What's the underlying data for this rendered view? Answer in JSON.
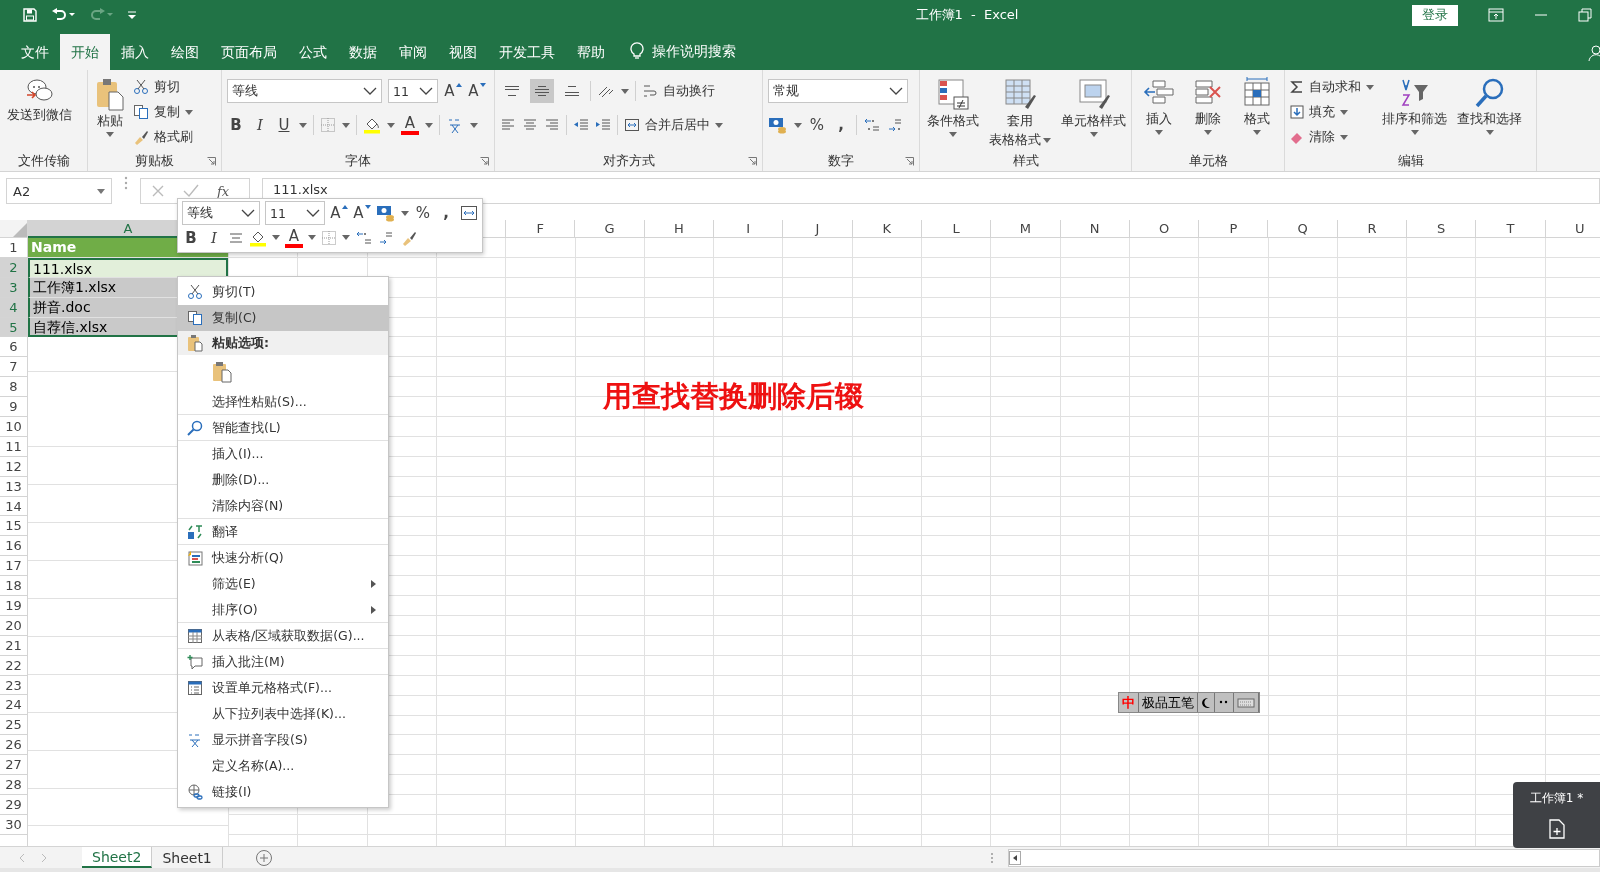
{
  "window": {
    "title": "工作簿1  -  Excel",
    "sign_in": "登录"
  },
  "menu_tabs": [
    {
      "label": "文件",
      "selected": false
    },
    {
      "label": "开始",
      "selected": true
    },
    {
      "label": "插入",
      "selected": false
    },
    {
      "label": "绘图",
      "selected": false
    },
    {
      "label": "页面布局",
      "selected": false
    },
    {
      "label": "公式",
      "selected": false
    },
    {
      "label": "数据",
      "selected": false
    },
    {
      "label": "审阅",
      "selected": false
    },
    {
      "label": "视图",
      "selected": false
    },
    {
      "label": "开发工具",
      "selected": false
    },
    {
      "label": "帮助",
      "selected": false
    }
  ],
  "tell_me": "操作说明搜索",
  "ribbon": {
    "file_transfer": {
      "button": "发送到微信",
      "group": "文件传输"
    },
    "clipboard": {
      "paste": "粘贴",
      "cut": "剪切",
      "copy": "复制",
      "format_painter": "格式刷",
      "group": "剪贴板"
    },
    "font": {
      "name": "等线",
      "size": "11",
      "grow": "A",
      "shrink": "A",
      "bold": "B",
      "italic": "I",
      "underline": "U",
      "font_color": "A",
      "group": "字体"
    },
    "alignment": {
      "vertical": [
        {
          "selected": false
        },
        {
          "selected": true
        },
        {
          "selected": false
        }
      ],
      "wrap": "自动换行",
      "merge": "合并后居中",
      "group": "对齐方式"
    },
    "number": {
      "format": "常规",
      "percent": "%",
      "comma": ",",
      "group": "数字"
    },
    "styles": {
      "conditional": "条件格式",
      "table_line1": "套用",
      "table_line2": "表格格式",
      "cell_styles": "单元格样式",
      "group": "样式"
    },
    "cells": {
      "insert": "插入",
      "delete": "删除",
      "format": "格式",
      "group": "单元格"
    },
    "editing": {
      "autosum": "自动求和",
      "fill": "填充",
      "clear": "清除",
      "sort": "排序和筛选",
      "find": "查找和选择",
      "group": "编辑"
    }
  },
  "formula_bar": {
    "name_box": "A2",
    "function_label": "fx",
    "value": "111.xlsx"
  },
  "grid": {
    "columns": [
      {
        "label": "A",
        "selected": true
      },
      {
        "label": "F",
        "selected": false
      },
      {
        "label": "G",
        "selected": false
      },
      {
        "label": "H",
        "selected": false
      },
      {
        "label": "I",
        "selected": false
      },
      {
        "label": "J",
        "selected": false
      },
      {
        "label": "K",
        "selected": false
      },
      {
        "label": "L",
        "selected": false
      },
      {
        "label": "M",
        "selected": false
      },
      {
        "label": "N",
        "selected": false
      },
      {
        "label": "O",
        "selected": false
      },
      {
        "label": "P",
        "selected": false
      },
      {
        "label": "Q",
        "selected": false
      },
      {
        "label": "R",
        "selected": false
      },
      {
        "label": "S",
        "selected": false
      },
      {
        "label": "T",
        "selected": false
      },
      {
        "label": "U",
        "selected": false
      }
    ],
    "rows": [
      {
        "label": "1",
        "selected": false
      },
      {
        "label": "2",
        "selected": true
      },
      {
        "label": "3",
        "selected": true
      },
      {
        "label": "4",
        "selected": true
      },
      {
        "label": "5",
        "selected": true
      },
      {
        "label": "6",
        "selected": false
      },
      {
        "label": "7",
        "selected": false
      },
      {
        "label": "8",
        "selected": false
      },
      {
        "label": "9",
        "selected": false
      },
      {
        "label": "10",
        "selected": false
      },
      {
        "label": "11",
        "selected": false
      },
      {
        "label": "12",
        "selected": false
      },
      {
        "label": "13",
        "selected": false
      },
      {
        "label": "14",
        "selected": false
      },
      {
        "label": "15",
        "selected": false
      },
      {
        "label": "16",
        "selected": false
      },
      {
        "label": "17",
        "selected": false
      },
      {
        "label": "18",
        "selected": false
      },
      {
        "label": "19",
        "selected": false
      },
      {
        "label": "20",
        "selected": false
      },
      {
        "label": "21",
        "selected": false
      },
      {
        "label": "22",
        "selected": false
      },
      {
        "label": "23",
        "selected": false
      },
      {
        "label": "24",
        "selected": false
      },
      {
        "label": "25",
        "selected": false
      },
      {
        "label": "26",
        "selected": false
      },
      {
        "label": "27",
        "selected": false
      },
      {
        "label": "28",
        "selected": false
      },
      {
        "label": "29",
        "selected": false
      },
      {
        "label": "30",
        "selected": false
      }
    ],
    "column_a": [
      {
        "text": "Name",
        "kind": "header"
      },
      {
        "text": "111.xlsx",
        "kind": "active"
      },
      {
        "text": "工作簿1.xlsx",
        "kind": "selected"
      },
      {
        "text": "拼音.doc",
        "kind": "selected"
      },
      {
        "text": "自荐信.xlsx",
        "kind": "selected"
      }
    ]
  },
  "note": "用查找替换删除后辍",
  "mini_toolbar": {
    "font": "等线",
    "size": "11",
    "grow": "A",
    "shrink": "A",
    "percent": "%",
    "comma": ",",
    "bold": "B",
    "italic": "I",
    "font_color": "A"
  },
  "context_menu": [
    {
      "kind": "command",
      "label": "剪切(T)",
      "selected": false,
      "divider": false,
      "submenu": false
    },
    {
      "kind": "command",
      "label": "复制(C)",
      "selected": true,
      "divider": false,
      "submenu": false
    },
    {
      "kind": "header",
      "label": "粘贴选项:"
    },
    {
      "kind": "paste_options"
    },
    {
      "kind": "command",
      "label": "选择性粘贴(S)...",
      "selected": false,
      "divider": true,
      "submenu": false
    },
    {
      "kind": "command",
      "label": "智能查找(L)",
      "selected": false,
      "divider": true,
      "submenu": false
    },
    {
      "kind": "command",
      "label": "插入(I)...",
      "selected": false,
      "divider": false,
      "submenu": false
    },
    {
      "kind": "command",
      "label": "删除(D)...",
      "selected": false,
      "divider": false,
      "submenu": false
    },
    {
      "kind": "command",
      "label": "清除内容(N)",
      "selected": false,
      "divider": true,
      "submenu": false
    },
    {
      "kind": "command",
      "label": "翻译",
      "selected": false,
      "divider": true,
      "submenu": false
    },
    {
      "kind": "command",
      "label": "快速分析(Q)",
      "selected": false,
      "divider": false,
      "submenu": false
    },
    {
      "kind": "command",
      "label": "筛选(E)",
      "selected": false,
      "divider": false,
      "submenu": true
    },
    {
      "kind": "command",
      "label": "排序(O)",
      "selected": false,
      "divider": true,
      "submenu": true
    },
    {
      "kind": "command",
      "label": "从表格/区域获取数据(G)...",
      "selected": false,
      "divider": true,
      "submenu": false
    },
    {
      "kind": "command",
      "label": "插入批注(M)",
      "selected": false,
      "divider": true,
      "submenu": false
    },
    {
      "kind": "command",
      "label": "设置单元格格式(F)...",
      "selected": false,
      "divider": false,
      "submenu": false
    },
    {
      "kind": "command",
      "label": "从下拉列表中选择(K)...",
      "selected": false,
      "divider": false,
      "submenu": false
    },
    {
      "kind": "command",
      "label": "显示拼音字段(S)",
      "selected": false,
      "divider": false,
      "submenu": false
    },
    {
      "kind": "command",
      "label": "定义名称(A)...",
      "selected": false,
      "divider": false,
      "submenu": false
    },
    {
      "kind": "command",
      "label": "链接(I)",
      "selected": false,
      "divider": false,
      "submenu": false
    }
  ],
  "sheet_tabs": [
    {
      "label": "Sheet2",
      "selected": true
    },
    {
      "label": "Sheet1",
      "selected": false
    }
  ],
  "ime_bar": {
    "mode": "中",
    "name": "极品五笔"
  },
  "window_popup": {
    "title": "工作簿1 *"
  }
}
